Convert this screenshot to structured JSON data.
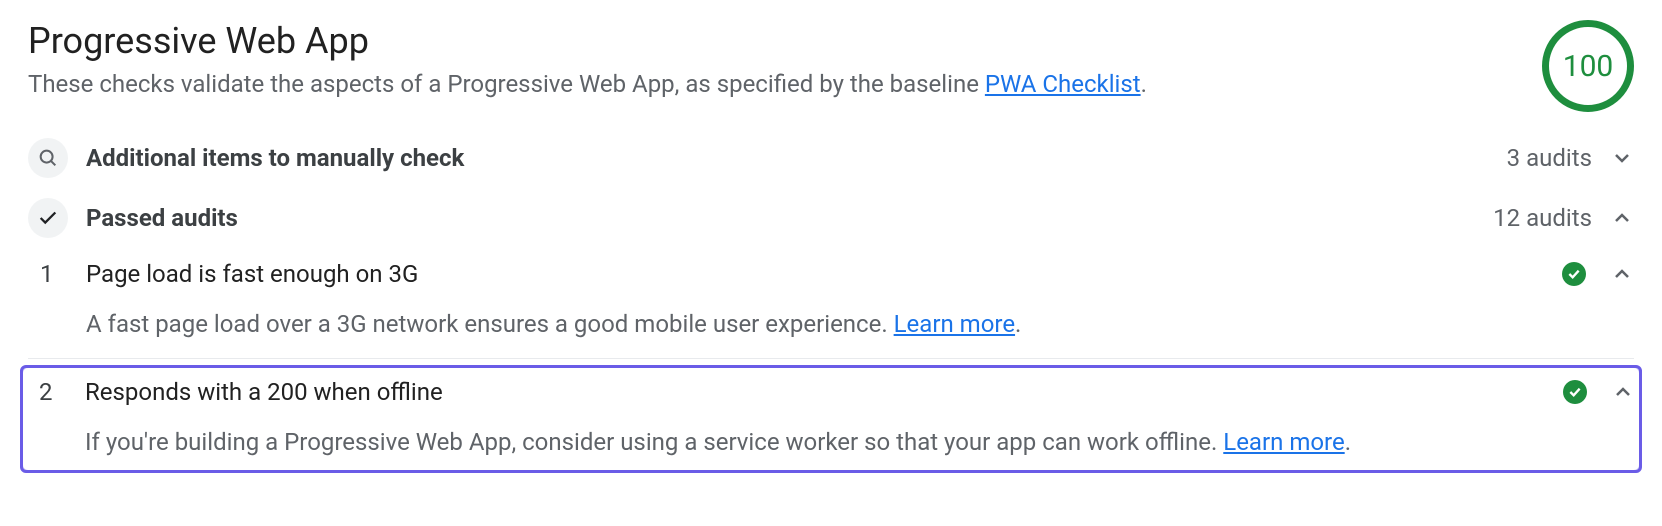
{
  "header": {
    "title": "Progressive Web App",
    "subtitle_prefix": "These checks validate the aspects of a Progressive Web App, as specified by the baseline ",
    "link_text": "PWA Checklist",
    "subtitle_suffix": ".",
    "score": "100"
  },
  "sections": {
    "manual": {
      "label": "Additional items to manually check",
      "count": "3 audits"
    },
    "passed": {
      "label": "Passed audits",
      "count": "12 audits"
    }
  },
  "audits": [
    {
      "index": "1",
      "title": "Page load is fast enough on 3G",
      "desc_prefix": "A fast page load over a 3G network ensures a good mobile user experience. ",
      "learn_more": "Learn more",
      "desc_suffix": "."
    },
    {
      "index": "2",
      "title": "Responds with a 200 when offline",
      "desc_prefix": "If you're building a Progressive Web App, consider using a service worker so that your app can work offline. ",
      "learn_more": "Learn more",
      "desc_suffix": "."
    }
  ]
}
